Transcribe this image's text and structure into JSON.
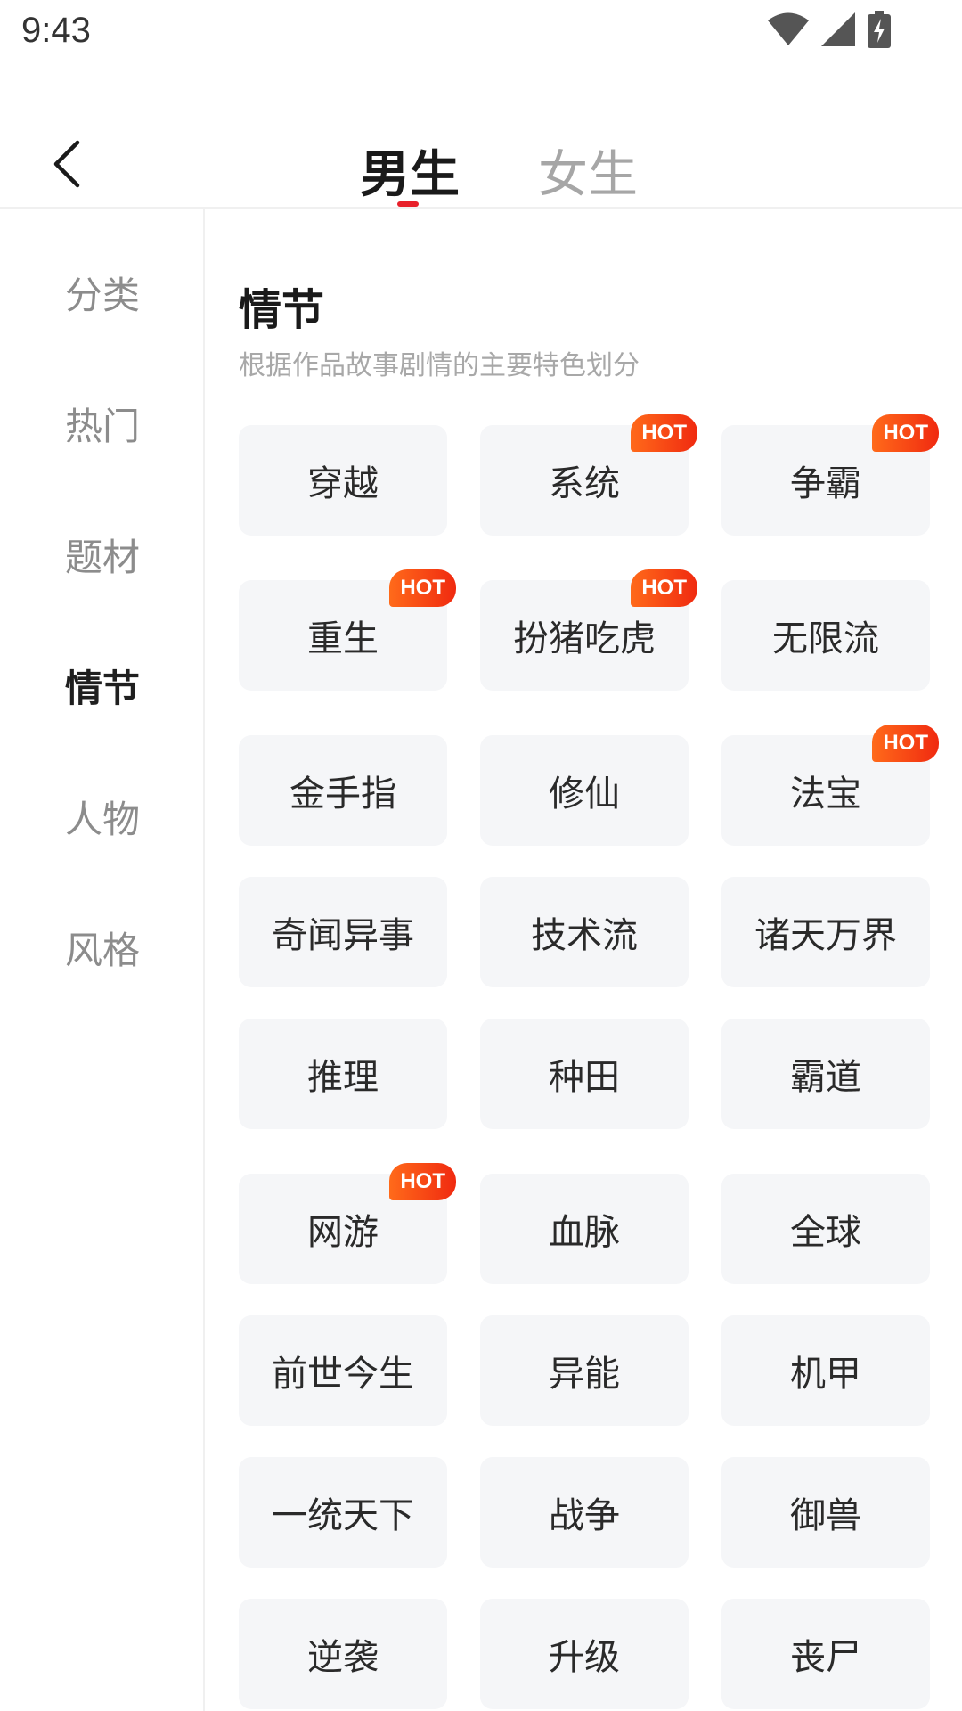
{
  "status_bar": {
    "time": "9:43",
    "icons": [
      "wifi-icon",
      "signal-icon",
      "battery-charging-icon"
    ]
  },
  "header": {
    "back_icon": "chevron-left-icon",
    "tabs": [
      {
        "label": "男生",
        "active": true
      },
      {
        "label": "女生",
        "active": false
      }
    ],
    "accent_color": "#e8202a"
  },
  "sidebar": {
    "items": [
      {
        "label": "分类",
        "active": false
      },
      {
        "label": "热门",
        "active": false
      },
      {
        "label": "题材",
        "active": false
      },
      {
        "label": "情节",
        "active": true
      },
      {
        "label": "人物",
        "active": false
      },
      {
        "label": "风格",
        "active": false
      }
    ]
  },
  "section": {
    "title": "情节",
    "description": "根据作品故事剧情的主要特色划分"
  },
  "hot_label": "HOT",
  "tags": [
    {
      "label": "穿越",
      "hot": false
    },
    {
      "label": "系统",
      "hot": true
    },
    {
      "label": "争霸",
      "hot": true
    },
    {
      "label": "重生",
      "hot": true
    },
    {
      "label": "扮猪吃虎",
      "hot": true
    },
    {
      "label": "无限流",
      "hot": false
    },
    {
      "label": "金手指",
      "hot": false
    },
    {
      "label": "修仙",
      "hot": false
    },
    {
      "label": "法宝",
      "hot": true
    },
    {
      "label": "奇闻异事",
      "hot": false
    },
    {
      "label": "技术流",
      "hot": false
    },
    {
      "label": "诸天万界",
      "hot": false
    },
    {
      "label": "推理",
      "hot": false
    },
    {
      "label": "种田",
      "hot": false
    },
    {
      "label": "霸道",
      "hot": false
    },
    {
      "label": "网游",
      "hot": true
    },
    {
      "label": "血脉",
      "hot": false
    },
    {
      "label": "全球",
      "hot": false
    },
    {
      "label": "前世今生",
      "hot": false
    },
    {
      "label": "异能",
      "hot": false
    },
    {
      "label": "机甲",
      "hot": false
    },
    {
      "label": "一统天下",
      "hot": false
    },
    {
      "label": "战争",
      "hot": false
    },
    {
      "label": "御兽",
      "hot": false
    },
    {
      "label": "逆袭",
      "hot": false
    },
    {
      "label": "升级",
      "hot": false
    },
    {
      "label": "丧尸",
      "hot": false
    }
  ]
}
